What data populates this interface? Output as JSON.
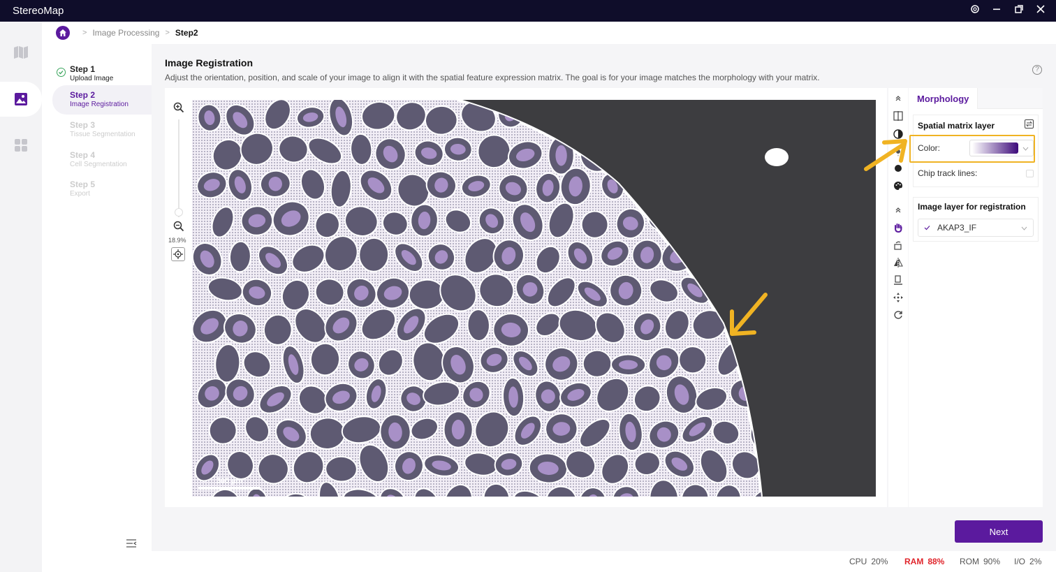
{
  "app": {
    "title": "StereoMap"
  },
  "breadcrumb": {
    "items": [
      "Image Processing",
      "Step2"
    ]
  },
  "steps": [
    {
      "title": "Step 1",
      "subtitle": "Upload Image",
      "state": "done"
    },
    {
      "title": "Step 2",
      "subtitle": "Image Registration",
      "state": "active"
    },
    {
      "title": "Step 3",
      "subtitle": "Tissue Segmentation",
      "state": "disabled"
    },
    {
      "title": "Step 4",
      "subtitle": "Cell Segmentation",
      "state": "disabled"
    },
    {
      "title": "Step 5",
      "subtitle": "Export",
      "state": "disabled"
    }
  ],
  "page": {
    "title": "Image Registration",
    "description": "Adjust the orientation, position, and scale of your image to align it with the spatial feature expression matrix. The goal is for your image matches the morphology with your matrix."
  },
  "viewer": {
    "zoom_label": "18.9%",
    "scalebar_label": "300 µm"
  },
  "panel": {
    "tab": "Morphology",
    "spatial_layer": {
      "title": "Spatial matrix layer",
      "color_label": "Color:",
      "chip_track_label": "Chip track lines:"
    },
    "image_layer": {
      "title": "Image layer for registration",
      "selected": "AKAP3_IF"
    }
  },
  "actions": {
    "next_label": "Next"
  },
  "status": {
    "cpu_label": "CPU",
    "cpu": "20%",
    "ram_label": "RAM",
    "ram": "88%",
    "rom_label": "ROM",
    "rom": "90%",
    "io_label": "I/O",
    "io": "2%"
  },
  "colors": {
    "accent": "#5b1a9e",
    "highlight": "#f0b323",
    "alert": "#e0262c",
    "titlebar": "#0f0d2a"
  }
}
